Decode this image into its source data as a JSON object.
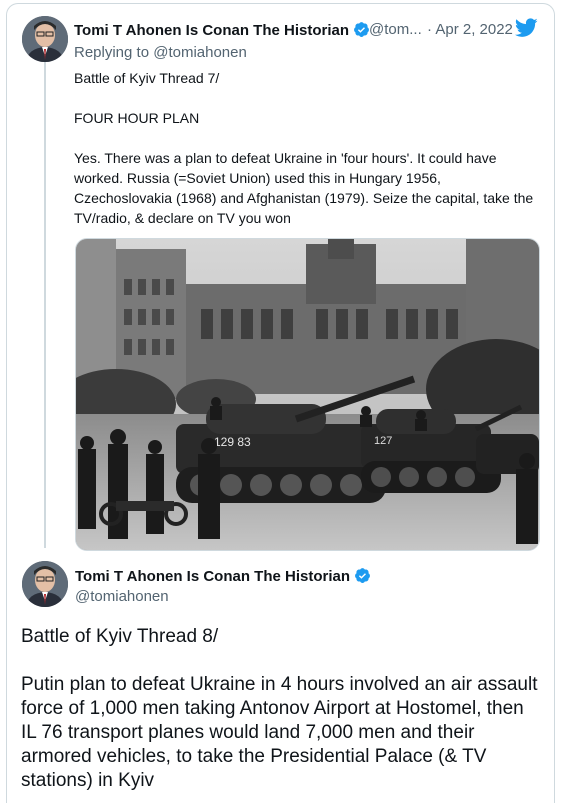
{
  "tweet1": {
    "author_name": "Tomi T Ahonen Is Conan The Historian",
    "handle": "@tom...",
    "separator": "·",
    "date": "Apr 2, 2022",
    "replying_prefix": "Replying to",
    "replying_handle": "@tomiahonen",
    "text_line1": "Battle of Kyiv Thread 7/",
    "text_line2": "FOUR HOUR PLAN",
    "text_line3": "Yes. There was a plan to defeat Ukraine in 'four hours'. It could have worked. Russia (=Soviet Union) used this in Hungary 1956, Czechoslovakia (1968) and Afghanistan (1979). Seize the capital, take the TV/radio, & declare on TV you won",
    "image_label_tank1": "129 83",
    "image_label_tank2": "127"
  },
  "tweet2": {
    "author_name": "Tomi T Ahonen Is Conan The Historian",
    "handle": "@tomiahonen",
    "text_line1": "Battle of Kyiv Thread 8/",
    "text_line2": "Putin plan to defeat Ukraine in 4 hours involved an air assault force of 1,000 men taking Antonov Airport at Hostomel, then IL 76 transport planes would land 7,000 men and their armored vehicles, to take the Presidential Palace (& TV stations) in Kyiv"
  },
  "colors": {
    "verified_blue": "#1d9bf0",
    "twitter_blue": "#1d9bf0",
    "secondary_text": "#536471",
    "border": "#cfd9de"
  },
  "icons": [
    "verified-badge-icon",
    "twitter-bird-icon"
  ]
}
